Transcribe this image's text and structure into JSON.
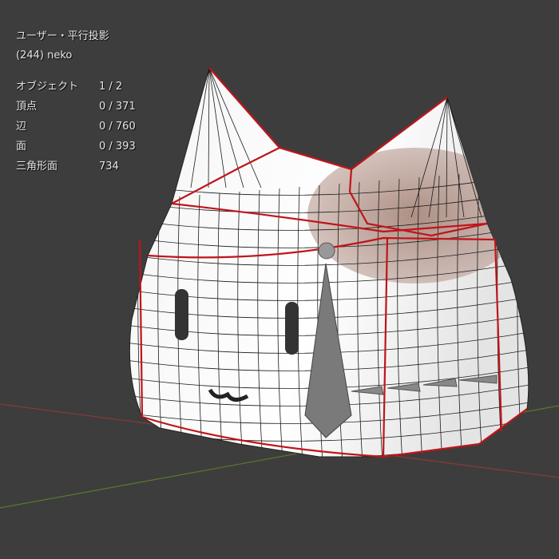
{
  "viewport": {
    "view_name": "ユーザー・平行投影",
    "object_info": "(244) neko",
    "stats": [
      {
        "label": "オブジェクト",
        "value": "1 / 2"
      },
      {
        "label": "頂点",
        "value": "0 / 371"
      },
      {
        "label": "辺",
        "value": "0 / 760"
      },
      {
        "label": "面",
        "value": "0 / 393"
      },
      {
        "label": "三角形面",
        "value": "734"
      }
    ]
  },
  "colors": {
    "background": "#3d3d3d",
    "seam": "#c0141a",
    "x_axis": "#8a3a3a",
    "y_axis": "#5a7a2a"
  }
}
